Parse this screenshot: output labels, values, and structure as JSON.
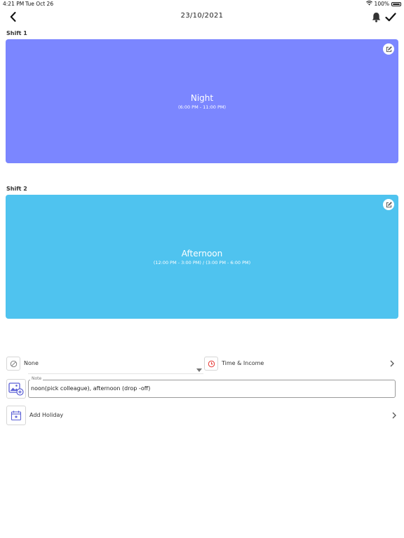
{
  "status_bar": {
    "time": "4:21 PM",
    "date": "Tue Oct 26",
    "battery": "100%"
  },
  "header": {
    "title": "23/10/2021"
  },
  "shifts": [
    {
      "label": "Shift 1",
      "name": "Night",
      "time": "(6:00 PM - 11:00 PM)",
      "color": "#7b86ff"
    },
    {
      "label": "Shift 2",
      "name": "Afternoon",
      "time": "(12:00 PM - 3:00 PM) / (3:00 PM - 6:00 PM)",
      "color": "#4fc3ef"
    }
  ],
  "options": {
    "category": "None",
    "time_income": "Time & Income",
    "note_label": "Note",
    "note_value": "noon(pick colleague), afternoon (drop -off)",
    "holiday": "Add Holiday"
  },
  "colors": {
    "clock_red": "#e53935",
    "icon_blue": "#5a5fd6"
  }
}
